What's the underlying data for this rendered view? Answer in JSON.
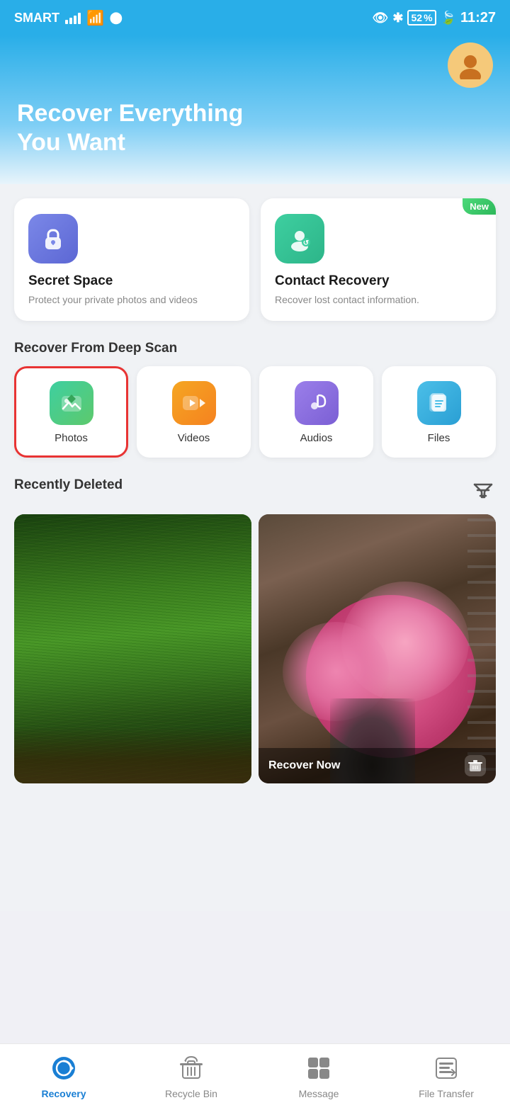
{
  "statusBar": {
    "carrier": "SMART",
    "time": "11:27",
    "batteryLevel": "52"
  },
  "header": {
    "title": "Recover Everything\nYou Want"
  },
  "topCards": [
    {
      "id": "secret-space",
      "icon": "lock-icon",
      "title": "Secret Space",
      "desc": "Protect your private photos and videos",
      "isNew": false
    },
    {
      "id": "contact-recovery",
      "icon": "contact-icon",
      "title": "Contact Recovery",
      "desc": "Recover lost contact information.",
      "isNew": true,
      "newLabel": "New"
    }
  ],
  "deepScan": {
    "sectionTitle": "Recover From Deep Scan",
    "items": [
      {
        "id": "photos",
        "label": "Photos",
        "selected": true
      },
      {
        "id": "videos",
        "label": "Videos",
        "selected": false
      },
      {
        "id": "audios",
        "label": "Audios",
        "selected": false
      },
      {
        "id": "files",
        "label": "Files",
        "selected": false
      }
    ]
  },
  "recentlyDeleted": {
    "sectionTitle": "Recently Deleted",
    "photos": [
      {
        "id": "grass",
        "hasRecover": false
      },
      {
        "id": "flower",
        "hasRecover": true,
        "recoverLabel": "Recover Now"
      }
    ]
  },
  "bottomNav": {
    "items": [
      {
        "id": "recovery",
        "label": "Recovery",
        "active": true
      },
      {
        "id": "recycle-bin",
        "label": "Recycle Bin",
        "active": false
      },
      {
        "id": "message",
        "label": "Message",
        "active": false
      },
      {
        "id": "file-transfer",
        "label": "File Transfer",
        "active": false
      }
    ]
  },
  "systemNav": {
    "back": "◁",
    "home": "○",
    "recent": "□"
  }
}
